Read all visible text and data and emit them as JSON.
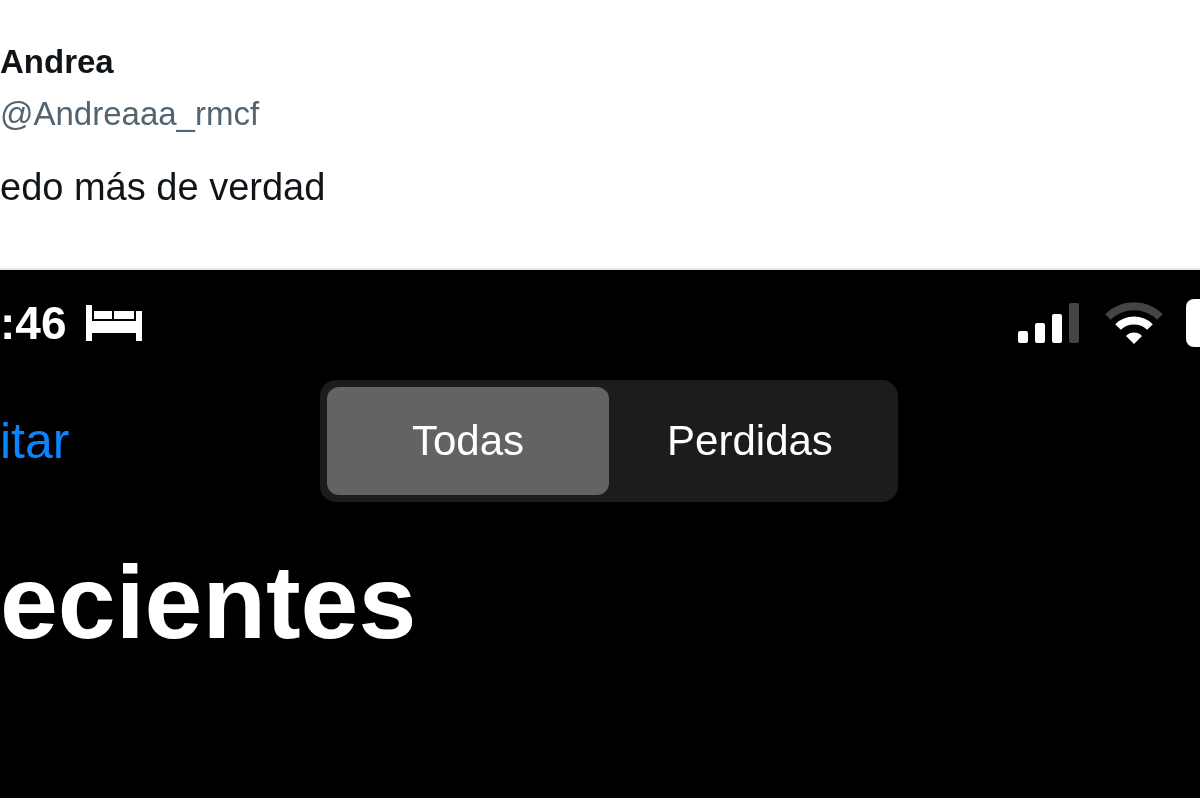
{
  "tweet": {
    "name": "Andrea",
    "handle": "@Andreaaa_rmcf",
    "text": "edo más de verdad"
  },
  "phone": {
    "status_bar": {
      "time": ":46"
    },
    "edit_link": "itar",
    "segments": [
      {
        "label": "Todas",
        "selected": true
      },
      {
        "label": "Perdidas",
        "selected": false
      }
    ],
    "title": "ecientes"
  }
}
